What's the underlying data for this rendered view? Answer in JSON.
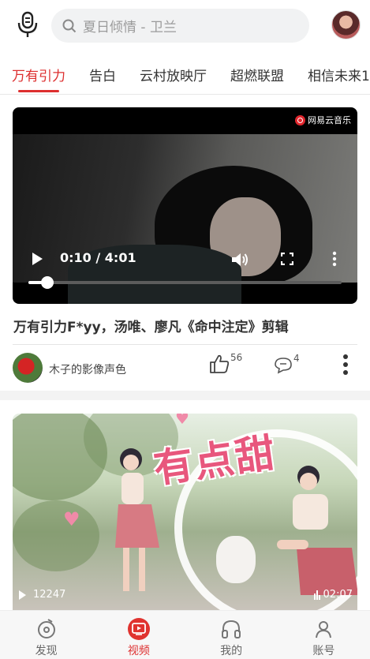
{
  "search": {
    "placeholder": "夏日倾情 - 卫兰"
  },
  "tabs": [
    {
      "label": "万有引力",
      "active": true
    },
    {
      "label": "告白",
      "active": false
    },
    {
      "label": "云村放映厅",
      "active": false
    },
    {
      "label": "超燃联盟",
      "active": false
    },
    {
      "label": "相信未来1",
      "active": false
    }
  ],
  "video1": {
    "badge": "网易云音乐",
    "time": "0:10 / 4:01",
    "progress": 0.06,
    "title": "万有引力F*yy，汤唯、廖凡《命中注定》剪辑",
    "author": "木子的影像声色",
    "likes": "56",
    "comments": "4"
  },
  "video2": {
    "overlay_text": "有点甜",
    "views": "12247",
    "duration": "02:07"
  },
  "nav": [
    {
      "label": "发现",
      "icon": "discover-icon",
      "active": false
    },
    {
      "label": "视频",
      "icon": "video-icon",
      "active": true
    },
    {
      "label": "我的",
      "icon": "headphones-icon",
      "active": false
    },
    {
      "label": "账号",
      "icon": "account-icon",
      "active": false
    }
  ],
  "colors": {
    "accent": "#dd2f2f"
  }
}
